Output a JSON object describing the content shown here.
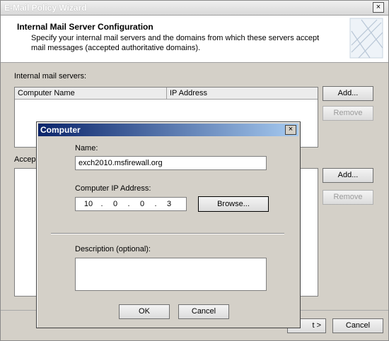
{
  "wizard": {
    "title": "E-Mail Policy Wizard",
    "header_title": "Internal Mail Server Configuration",
    "header_desc": "Specify your internal mail servers and the domains from which these servers accept mail messages (accepted authoritative domains).",
    "internal_label": "Internal mail servers:",
    "columns": [
      "Computer Name",
      "IP Address"
    ],
    "accepted_label_partial": "Accep",
    "add_label": "Add...",
    "remove_label": "Remove",
    "next_partial": "t >",
    "cancel_label": "Cancel"
  },
  "dialog": {
    "title": "Computer",
    "name_label": "Name:",
    "name_value": "exch2010.msfirewall.org",
    "ip_label": "Computer IP Address:",
    "ip_octets": [
      "10",
      "0",
      "0",
      "3"
    ],
    "browse_label": "Browse...",
    "desc_label": "Description (optional):",
    "desc_value": "",
    "ok_label": "OK",
    "cancel_label": "Cancel"
  }
}
